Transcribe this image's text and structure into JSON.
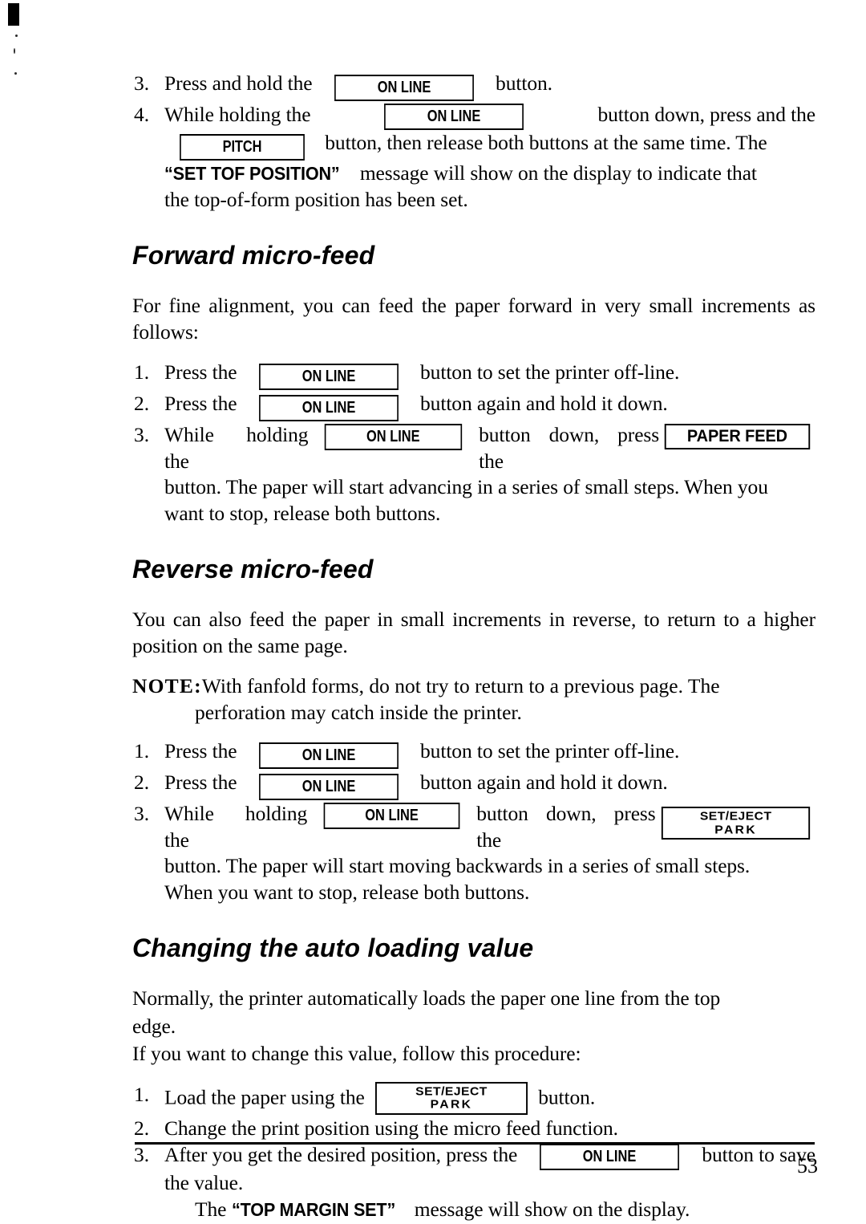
{
  "document": {
    "page_number": "53",
    "buttons": {
      "on_line": "ON LINE",
      "pitch": "PITCH",
      "paper_feed": "PAPER FEED",
      "set_eject_line1": "SET/EJECT",
      "set_eject_line2": "PARK"
    },
    "messages": {
      "set_tof_position": "“SET TOF POSITION”",
      "top_margin_set": "“TOP MARGIN SET”"
    },
    "top_steps": [
      {
        "number": "3.",
        "text_before": "Press and hold the",
        "button": "on_line",
        "text_after": "button."
      },
      {
        "number": "4.",
        "segments_line1_before": "While holding the",
        "segments_line1_after": "button down, press and the",
        "segments_line2_after": "button, then release both buttons at the same time. The",
        "segments_line3_after": "message will show on the display to indicate that",
        "segments_line4": "the top-of-form position has been set."
      }
    ],
    "sections": [
      {
        "id": "forward-micro-feed",
        "heading": "Forward micro-feed",
        "intro": "For fine alignment, you can feed the paper forward in very small increments as follows:",
        "steps": [
          {
            "number": "1.",
            "before": "Press the",
            "after": "button to set the printer off-line."
          },
          {
            "number": "2.",
            "before": "Press the",
            "after": "button again and hold it down."
          },
          {
            "number": "3.",
            "before": "While holding the",
            "middle": "button down, press the",
            "continuation_line1": "button. The paper will start advancing in a series of small steps. When you",
            "continuation_line2": "want to stop, release both buttons."
          }
        ]
      },
      {
        "id": "reverse-micro-feed",
        "heading": "Reverse micro-feed",
        "intro": "You can also feed the paper in small increments in reverse, to return to a higher position on the same page.",
        "note_label": "NOTE:",
        "note_line1": "With fanfold forms, do not try to return to a previous page. The",
        "note_line2": "perforation may catch inside the printer.",
        "steps": [
          {
            "number": "1.",
            "before": "Press the",
            "after": "button to set the printer off-line."
          },
          {
            "number": "2.",
            "before": "Press the",
            "after": "button again and hold it down."
          },
          {
            "number": "3.",
            "before": "While holding the",
            "middle": "button down, press the",
            "continuation_line1": "button. The paper will start moving backwards in a series of small steps.",
            "continuation_line2": "When you want to stop, release both buttons."
          }
        ]
      },
      {
        "id": "changing-auto-loading-value",
        "heading": "Changing the auto loading value",
        "intro_line1": "Normally, the printer automatically loads the paper one line from the top",
        "intro_line2": "edge.",
        "intro_line3": "If you want to change this value, follow this procedure:",
        "steps": [
          {
            "number": "1.",
            "before": "Load the paper using the",
            "after": "button."
          },
          {
            "number": "2.",
            "text": "Change the print position using the micro feed function."
          },
          {
            "number": "3.",
            "before": "After you get the desired position, press the",
            "after": "button to save",
            "continuation_line1": "the value.",
            "continuation_line2_before": "The",
            "continuation_line2_after": "message will show on the display."
          }
        ]
      }
    ]
  }
}
